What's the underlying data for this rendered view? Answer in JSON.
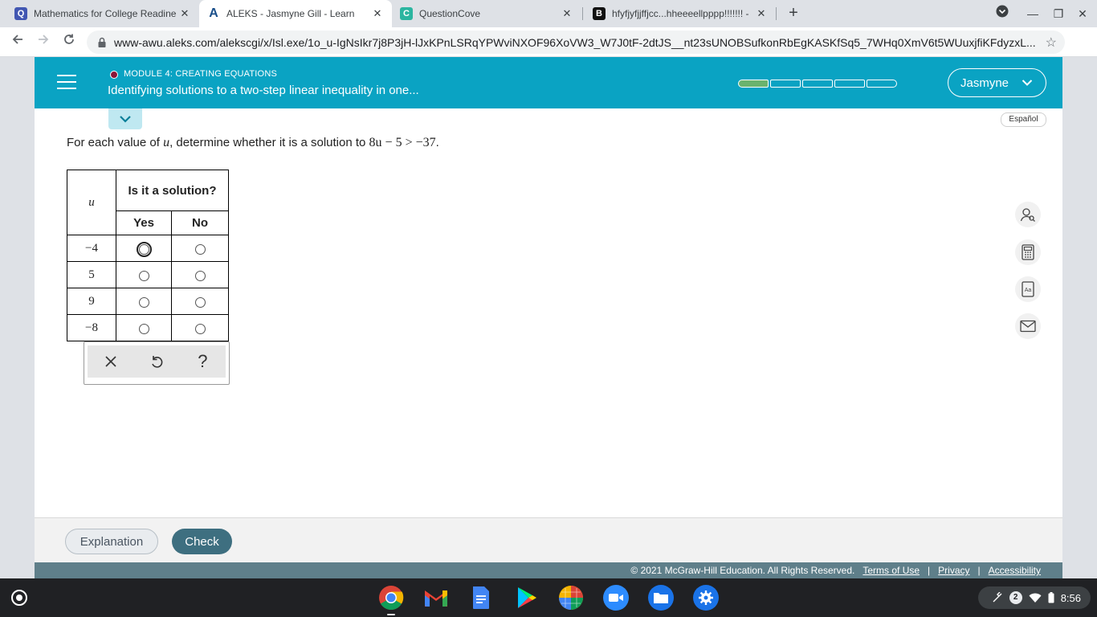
{
  "browser": {
    "tabs": [
      {
        "title": "Mathematics for College Readine",
        "icon": "quizlet-icon"
      },
      {
        "title": "ALEKS - Jasmyne Gill - Learn",
        "icon": "aleks-icon",
        "active": true
      },
      {
        "title": "QuestionCove",
        "icon": "questioncove-icon"
      },
      {
        "title": "hfyfjyfjjffjcc...hheeeellpppp!!!!!!! -",
        "icon": "brainly-icon"
      }
    ],
    "url": "www-awu.aleks.com/alekscgi/x/Isl.exe/1o_u-IgNsIkr7j8P3jH-lJxKPnLSRqYPWviNXOF96XoVW3_W7J0tF-2dtJS__nt23sUNOBSufkonRbEgKASKfSq5_7WHq0XmV6t5WUuxjfiKFdyzxL..."
  },
  "header": {
    "module": "MODULE 4: CREATING EQUATIONS",
    "topic": "Identifying solutions to a two-step linear inequality in one...",
    "user": "Jasmyne",
    "progress_segments": [
      true,
      false,
      false,
      false,
      false
    ]
  },
  "language_label": "Español",
  "question": {
    "prefix": "For each value of ",
    "variable": "u",
    "middle": ", determine whether it is a solution to ",
    "inequality": "8u − 5 > −37",
    "suffix": "."
  },
  "table": {
    "var_header": "u",
    "solution_header": "Is it a solution?",
    "yes_label": "Yes",
    "no_label": "No",
    "rows": [
      "−4",
      "5",
      "9",
      "−8"
    ]
  },
  "footer": {
    "explanation": "Explanation",
    "check": "Check",
    "copyright": "© 2021 McGraw-Hill Education. All Rights Reserved.",
    "terms": "Terms of Use",
    "privacy": "Privacy",
    "accessibility": "Accessibility"
  },
  "shelf": {
    "notifications": "2",
    "time": "8:56"
  },
  "colors": {
    "header": "#0aa3c3",
    "check_button": "#3e6f80",
    "progress_done": "#6bb36e"
  }
}
